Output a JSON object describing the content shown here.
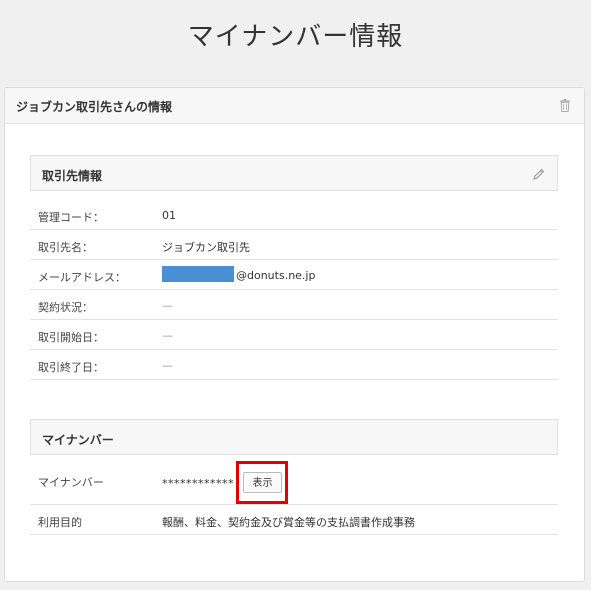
{
  "page": {
    "title": "マイナンバー情報"
  },
  "card": {
    "title": "ジョブカン取引先さんの情報"
  },
  "client_section": {
    "title": "取引先情報",
    "rows": [
      {
        "label": "管理コード：",
        "value": "01"
      },
      {
        "label": "取引先名：",
        "value": "ジョブカン取引先"
      },
      {
        "label": "メールアドレス：",
        "value": "@donuts.ne.jp"
      },
      {
        "label": "契約状況：",
        "value": "—"
      },
      {
        "label": "取引開始日：",
        "value": "—"
      },
      {
        "label": "取引終了日：",
        "value": "—"
      }
    ]
  },
  "mynumber_section": {
    "title": "マイナンバー",
    "number_label": "マイナンバー",
    "number_masked": "************",
    "show_button": "表示",
    "purpose_label": "利用目的",
    "purpose_value": "報酬、料金、契約金及び賞金等の支払調書作成事務"
  },
  "icons": {
    "delete": "trash-icon",
    "edit": "pencil-icon"
  },
  "colors": {
    "redaction": "#4a8fd4",
    "highlight": "#e00000"
  }
}
